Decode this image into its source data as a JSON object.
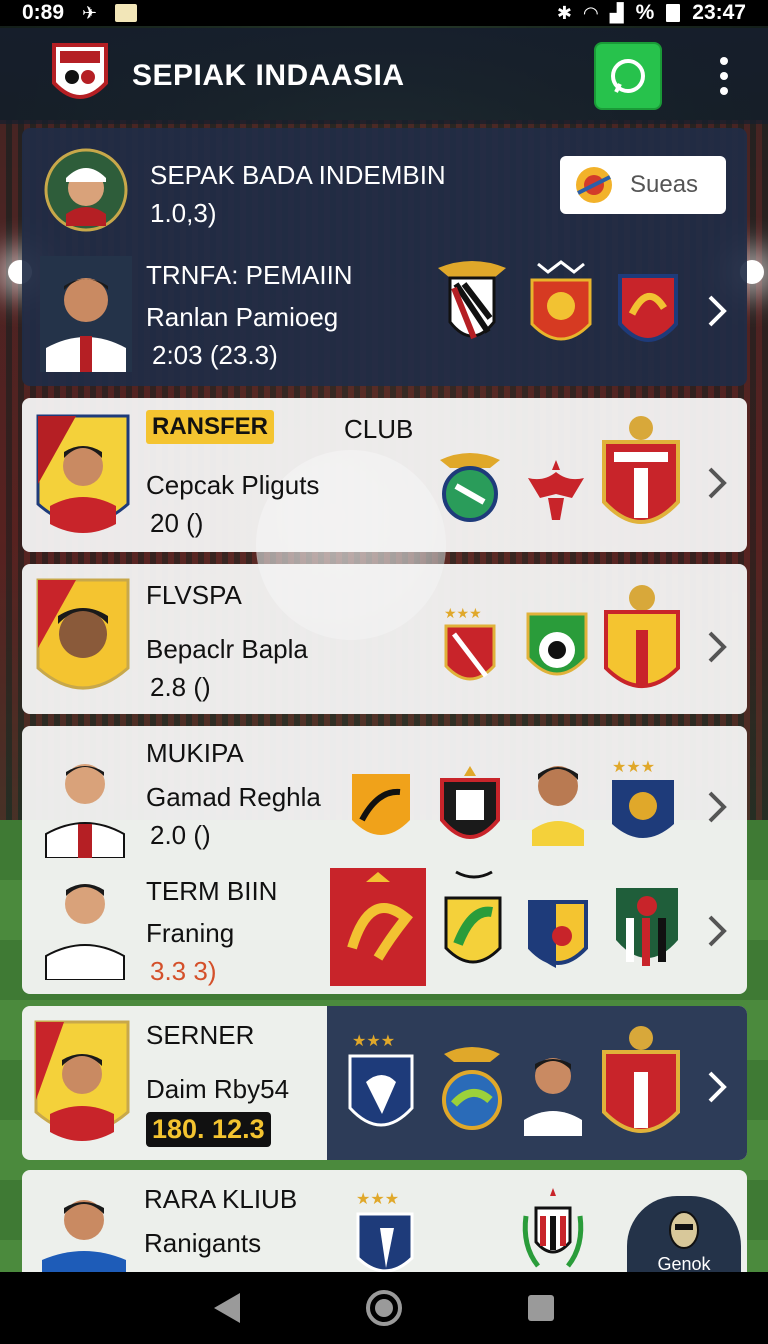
{
  "status_bar": {
    "time_left": "0:89",
    "battery_text": "%",
    "time_right": "23:47"
  },
  "app": {
    "title": "SEPIAK INDAASIA"
  },
  "featured": {
    "title": "SEPAK BADA INDEMBIN",
    "score": "1.0,3)",
    "search_label": "Sueas",
    "transfer": {
      "name": "TRNFA: PEMAIIN",
      "sub": "Ranlan Pamioeg",
      "value": "2:03 (23.3)"
    }
  },
  "cards": [
    {
      "tag": "RANSFER",
      "club_label": "CLUB",
      "name": "Cepcak Pliguts",
      "value": "20 ()"
    },
    {
      "name": "FLVSPA",
      "sub": "Bepaclr Bapla",
      "value": "2.8 ()"
    },
    {
      "name": "MUKIPA",
      "sub": "Gamad Reghla",
      "value": "2.0 ()"
    },
    {
      "name": "TERM BIIN",
      "sub": "Franing",
      "value": "3.3 3)"
    },
    {
      "name": "SERNER",
      "sub": "Daim Rby54",
      "value": "180. 12.3"
    },
    {
      "name": "RARA KLIUB",
      "sub": "Ranigants",
      "value": ""
    }
  ],
  "fab": {
    "label": "Genok"
  },
  "colors": {
    "accent_green": "#27c24c",
    "dark_card": "#212d46",
    "tag_yellow": "#f4c430",
    "value_orange": "#d4502a"
  }
}
